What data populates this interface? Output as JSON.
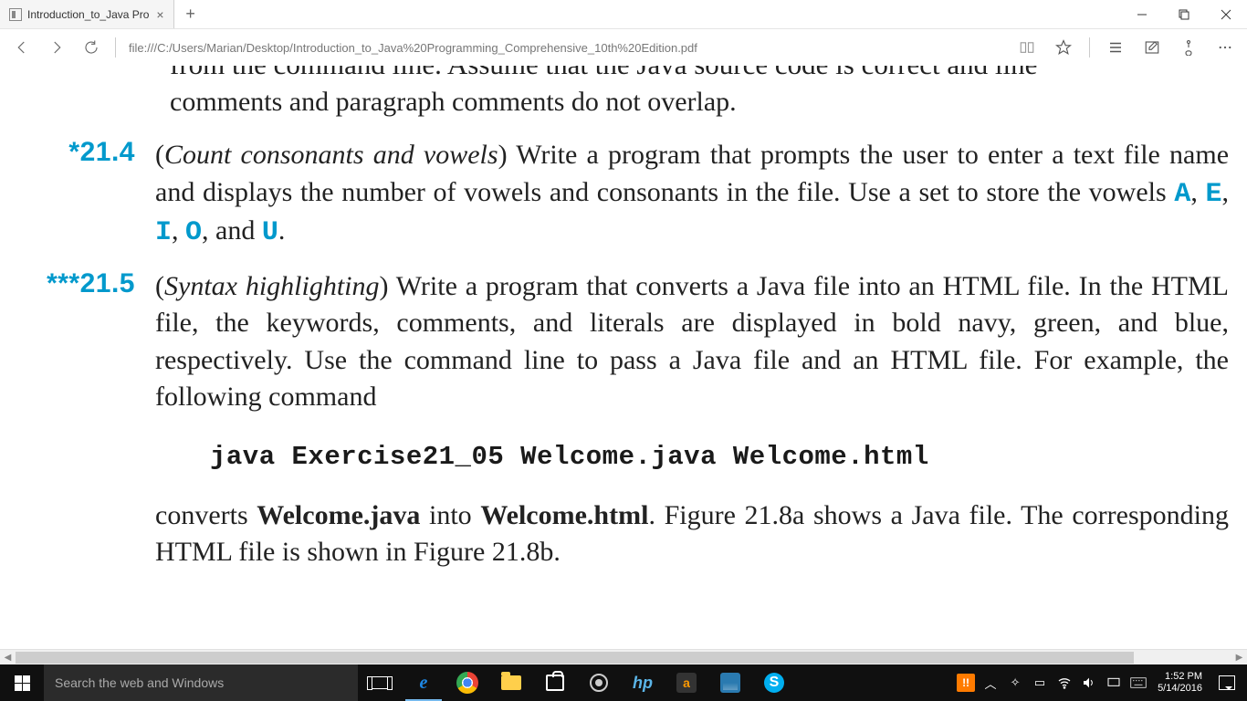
{
  "window": {
    "tab_title": "Introduction_to_Java Pro",
    "url": "file:///C:/Users/Marian/Desktop/Introduction_to_Java%20Programming_Comprehensive_10th%20Edition.pdf"
  },
  "document": {
    "cut_line": "from the command line. Assume that the Java source code is correct and line",
    "prev_tail": "comments and paragraph comments do not overlap.",
    "ex214": {
      "num": "*21.4",
      "title": "Count consonants and vowels",
      "body_pre": ") Write a program that prompts the user to enter a text file name and displays the number of vowels and consonants in the file. Use a set to store the vowels ",
      "vowels": {
        "a": "A",
        "e": "E",
        "i": "I",
        "o": "O",
        "u": "U"
      },
      "body_post": "."
    },
    "ex215": {
      "num": "***21.5",
      "title": "Syntax highlighting",
      "body": ") Write a program that converts a Java file into an HTML file. In the HTML file, the keywords, comments, and literals are displayed in bold navy, green, and blue, respectively. Use the command line to pass a Java file and an HTML file. For example, the following command",
      "code": "java Exercise21_05 Welcome.java Welcome.html",
      "after_pre": "converts ",
      "wjava": "Welcome.java",
      "after_mid": " into ",
      "whtml": "Welcome.html",
      "after_post": ". Figure 21.8a shows a Java file. The corresponding HTML file is shown in Figure 21.8b."
    }
  },
  "taskbar": {
    "search_placeholder": "Search the web and Windows",
    "time": "1:52 PM",
    "date": "5/14/2016",
    "badge": "!!"
  }
}
